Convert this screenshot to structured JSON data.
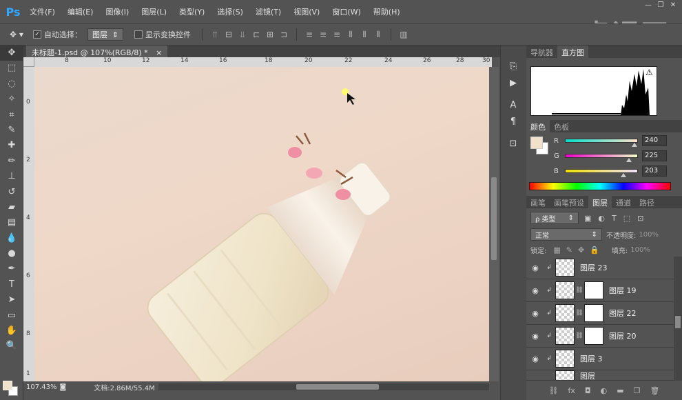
{
  "app": {
    "logo": "Ps"
  },
  "menu": [
    "文件(F)",
    "编辑(E)",
    "图像(I)",
    "图层(L)",
    "类型(Y)",
    "选择(S)",
    "滤镜(T)",
    "视图(V)",
    "窗口(W)",
    "帮助(H)"
  ],
  "watermark": "虎课网",
  "window_controls": {
    "minimize": "—",
    "restore": "❐",
    "close": "✕"
  },
  "options": {
    "auto_select_label": "自动选择：",
    "auto_select_checked": true,
    "auto_select_value": "图层",
    "show_transform_label": "显示变换控件",
    "show_transform_checked": false
  },
  "document": {
    "tab_title": "未标题-1.psd @ 107%(RGB/8) *",
    "close": "×",
    "ruler_h": [
      "8",
      "10",
      "12",
      "14",
      "16",
      "18",
      "20",
      "22",
      "24",
      "26",
      "28",
      "30"
    ],
    "ruler_v": [
      "0",
      "2",
      "4",
      "6",
      "8",
      "1"
    ],
    "zoom": "107.43%",
    "doc_info": "文档:2.86M/55.4M"
  },
  "panels": {
    "top_tabs": [
      "导航器",
      "直方图"
    ],
    "color_tabs": [
      "颜色",
      "色板"
    ],
    "color": {
      "r_label": "R",
      "r": "240",
      "g_label": "G",
      "g": "225",
      "b_label": "B",
      "b": "203",
      "fg": "#f0e1cb"
    },
    "layer_tabs": [
      "画笔",
      "画笔预设",
      "图层",
      "通道",
      "路径"
    ],
    "filter_type": "ρ 类型",
    "blend_mode": "正常",
    "opacity_label": "不透明度:",
    "opacity_value": "100%",
    "lock_label": "锁定:",
    "fill_label": "填充:",
    "fill_value": "100%",
    "layers": [
      {
        "name": "图层 23",
        "mask": false
      },
      {
        "name": "图层 19",
        "mask": true
      },
      {
        "name": "图层 22",
        "mask": true
      },
      {
        "name": "图层 20",
        "mask": true
      },
      {
        "name": "图层 3",
        "mask": false
      },
      {
        "name": "图层",
        "mask": false
      }
    ],
    "footer_icons": [
      "link-icon",
      "fx-icon",
      "mask-icon",
      "adjustment-icon",
      "folder-icon",
      "new-layer-icon",
      "trash-icon"
    ]
  }
}
